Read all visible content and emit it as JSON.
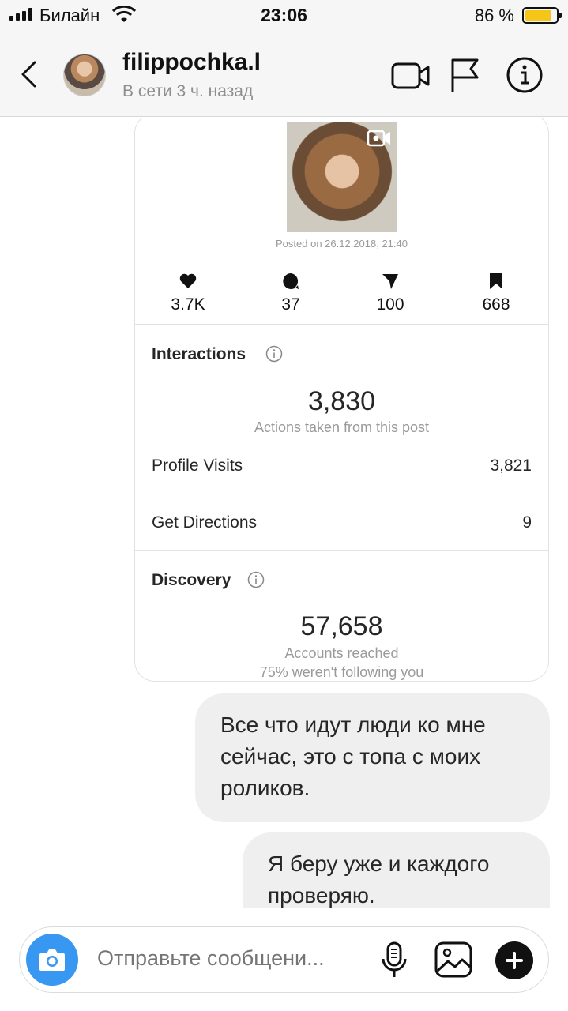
{
  "status_bar": {
    "carrier": "Билайн",
    "time": "23:06",
    "battery_text": "86 %",
    "battery_level": 0.86,
    "battery_color": "#f5c518"
  },
  "header": {
    "username": "filippochka.l",
    "status": "В сети 3 ч. назад",
    "icons": [
      "back-chevron-icon",
      "video-call-icon",
      "flag-icon",
      "info-icon"
    ]
  },
  "post_card": {
    "posted_on": "Posted on 26.12.2018, 21:40",
    "stats": [
      {
        "icon": "heart-icon",
        "value": "3.7K"
      },
      {
        "icon": "comment-icon",
        "value": "37"
      },
      {
        "icon": "send-icon",
        "value": "100"
      },
      {
        "icon": "bookmark-icon",
        "value": "668"
      }
    ],
    "interactions": {
      "title": "Interactions",
      "total": "3,830",
      "total_caption": "Actions taken from this post",
      "rows": [
        {
          "label": "Profile Visits",
          "value": "3,821"
        },
        {
          "label": "Get Directions",
          "value": "9"
        }
      ]
    },
    "discovery": {
      "title": "Discovery",
      "total": "57,658",
      "total_caption": "Accounts reached",
      "note": "75% weren't following you"
    }
  },
  "messages": [
    {
      "text": "Все что идут люди ко мне сейчас, это с топа с моих роликов."
    },
    {
      "text": "Я беру уже и каждого проверяю."
    }
  ],
  "composer": {
    "placeholder": "Отправьте сообщени...",
    "accent_color": "#3897f0"
  }
}
